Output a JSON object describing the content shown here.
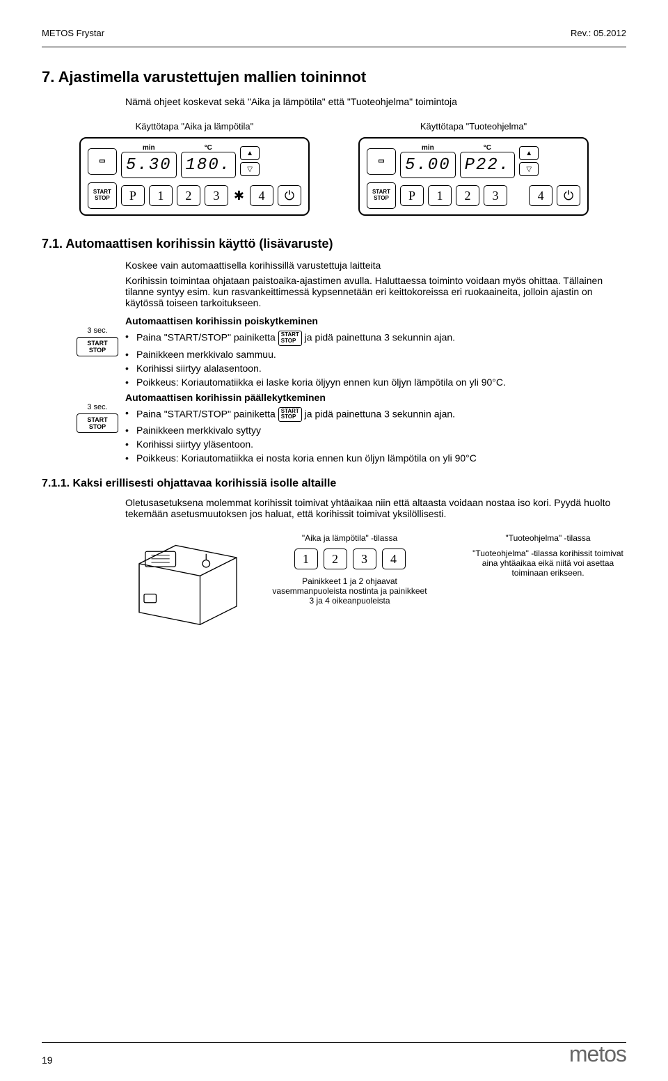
{
  "header": {
    "left": "METOS Frystar",
    "right": "Rev.: 05.2012"
  },
  "h1": "7. Ajastimella varustettujen mallien toininnot",
  "intro": "Nämä ohjeet koskevat sekä \"Aika ja lämpötila\" että \"Tuoteohjelma\" toimintoja",
  "panel1": {
    "caption": "Käyttötapa \"Aika ja lämpötila\"",
    "lcd1": "5.30",
    "lcd2": "180.",
    "unit1": "min",
    "unit2": "°C"
  },
  "panel2": {
    "caption": "Käyttötapa \"Tuoteohjelma\"",
    "lcd1": "5.00",
    "lcd2": "P22.",
    "unit1": "min",
    "unit2": "°C"
  },
  "start_stop": "START\nSTOP",
  "p_btn": "P",
  "nums": [
    "1",
    "2",
    "3",
    "4"
  ],
  "power": "⏻",
  "h2": "7.1. Automaattisen korihissin käyttö (lisävaruste)",
  "sub1": "Koskee vain automaattisella korihissillä varustettuja laitteita",
  "sub2": "Korihissin toimintaa ohjataan paistoaika-ajastimen avulla. Haluttaessa toiminto voidaan myös ohittaa. Tällainen tilanne syntyy esim. kun rasvankeittimessä kypsennetään eri keittokoreissa eri ruokaaineita, jolloin ajastin on käytössä toiseen tarkoitukseen.",
  "sec_off": {
    "title": "Automaattisen korihissin poiskytkeminen",
    "time": "3 sec.",
    "ss": "START\nSTOP",
    "b1a": "Paina \"START/STOP\" painiketta ",
    "b1b": " ja pidä painettuna 3 sekunnin ajan.",
    "b2": "Painikkeen merkkivalo sammuu.",
    "b3": "Korihissi siirtyy alalasentoon.",
    "b4": "Poikkeus: Koriautomatiikka ei laske koria öljyyn ennen kun öljyn lämpötila on yli 90°C."
  },
  "sec_on": {
    "title": "Automaattisen korihissin päällekytkeminen",
    "time": "3 sec.",
    "ss": "START\nSTOP",
    "b1a": "Paina \"START/STOP\" painiketta ",
    "b1b": " ja pidä painettuna 3 sekunnin ajan.",
    "b2": "Painikkeen merkkivalo syttyy",
    "b3": "Korihissi siirtyy yläsentoon.",
    "b4": "Poikkeus: Koriautomatiikka ei nosta koria ennen kun öljyn lämpötila on yli 90°C"
  },
  "h3": "7.1.1. Kaksi erillisesti ohjattavaa korihissiä isolle altaille",
  "h3_body": "Oletusasetuksena molemmat korihissit toimivat yhtäaikaa niin että altaasta voidaan nostaa iso kori. Pyydä huolto tekemään asetusmuutoksen jos haluat,  että korihissit toimivat yksilöllisesti.",
  "mode_left": {
    "title": "\"Aika ja lämpötila\" -tilassa",
    "nums": [
      "1",
      "2",
      "3",
      "4"
    ],
    "note": "Painikkeet 1 ja 2 ohjaavat vasemmanpuoleista nostinta ja painikkeet 3 ja 4 oikeanpuoleista"
  },
  "mode_right": {
    "title": "\"Tuoteohjelma\" -tilassa",
    "note": "\"Tuoteohjelma\" -tilassa korihissit toimivat aina yhtäaikaa eikä niitä voi asettaa toiminaan erikseen."
  },
  "footer": {
    "logo": "metos",
    "page": "19"
  }
}
